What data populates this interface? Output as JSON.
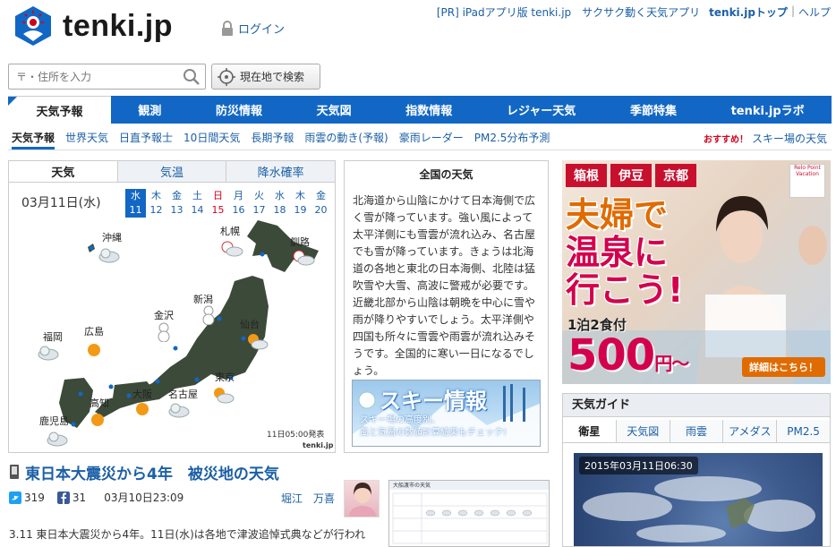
{
  "header": {
    "logo_text": "tenki.jp",
    "login": "ログイン",
    "pr": "[PR] iPadアプリ版 tenki.jp　サクサク動く天気アプリ",
    "top_link": "tenki.jpトップ",
    "help": "ヘルプ",
    "separator": "|"
  },
  "search": {
    "placeholder": "〒・住所を入力",
    "locate_label": "現在地で検索"
  },
  "main_nav": [
    "天気予報",
    "観測",
    "防災情報",
    "天気図",
    "指数情報",
    "レジャー天気",
    "季節特集",
    "tenki.jpラボ"
  ],
  "sub_nav": [
    "天気予報",
    "世界天気",
    "日直予報士",
    "10日間天気",
    "長期予報",
    "雨雲の動き(予報)",
    "豪雨レーダー",
    "PM2.5分布予測"
  ],
  "recommend": {
    "tag": "おすすめ！",
    "label": "スキー場の天気"
  },
  "forecast": {
    "tabs": [
      "天気",
      "気温",
      "降水確率"
    ],
    "date": "03月11日(水)",
    "days": [
      {
        "w": "水",
        "d": "11"
      },
      {
        "w": "木",
        "d": "12"
      },
      {
        "w": "金",
        "d": "13"
      },
      {
        "w": "土",
        "d": "14"
      },
      {
        "w": "日",
        "d": "15"
      },
      {
        "w": "月",
        "d": "16"
      },
      {
        "w": "火",
        "d": "17"
      },
      {
        "w": "水",
        "d": "18"
      },
      {
        "w": "木",
        "d": "19"
      },
      {
        "w": "金",
        "d": "20"
      }
    ],
    "cities": [
      "沖縄",
      "札幌",
      "釧路",
      "新潟",
      "金沢",
      "仙台",
      "福岡",
      "広島",
      "大阪",
      "名古屋",
      "東京",
      "高知",
      "鹿児島"
    ],
    "issued": "11日05:00発表",
    "credit": "tenki.jp"
  },
  "national": {
    "title": "全国の天気",
    "text": "北海道から山陰にかけて日本海側で広く雪が降っています。強い風によって太平洋側にも雪雲が流れ込み、名古屋でも雪が降っています。きょうは北海道の各地と東北の日本海側、北陸は猛吹雪や大雪、高波に警戒が必要です。近畿北部から山陰は朝晩を中心に雪や雨が降りやすいでしょう。太平洋側や四国も所々に雪雲や雨雲が流れ込みそうです。全国的に寒い一日になるでしょう。",
    "ski_title": "スキー情報",
    "ski_sub_1": "スキー場の高度別、",
    "ski_sub_2": "風と気温の数値計算結果もチェック!"
  },
  "news": {
    "title": "東日本大震災から4年　被災地の天気",
    "twitter_count": "319",
    "facebook_count": "31",
    "date": "03月10日23:09",
    "author": "堀江　万喜",
    "summary": "3.11 東日本大震災から4年。11日(水)は各地で津波追悼式典などが行われ",
    "thumb_title": "大船渡市の天気"
  },
  "ad": {
    "tags": [
      "箱根",
      "伊豆",
      "京都"
    ],
    "headline_1": "夫婦で",
    "headline_2": "温泉に",
    "headline_3": "行こう!",
    "sub": "1泊2食付",
    "price": "500",
    "price_suffix": "円〜",
    "cta": "詳細はこちら！",
    "brand": "Relo Point Vacation"
  },
  "guide": {
    "title": "天気ガイド",
    "tabs": [
      "衛星",
      "天気図",
      "雨雲",
      "アメダス",
      "PM2.5"
    ],
    "sat_time": "2015年03月11日06:30"
  },
  "colors": {
    "brand_blue": "#1267c4",
    "link_blue": "#1b5fa5",
    "sunday_red": "#d0021b"
  }
}
